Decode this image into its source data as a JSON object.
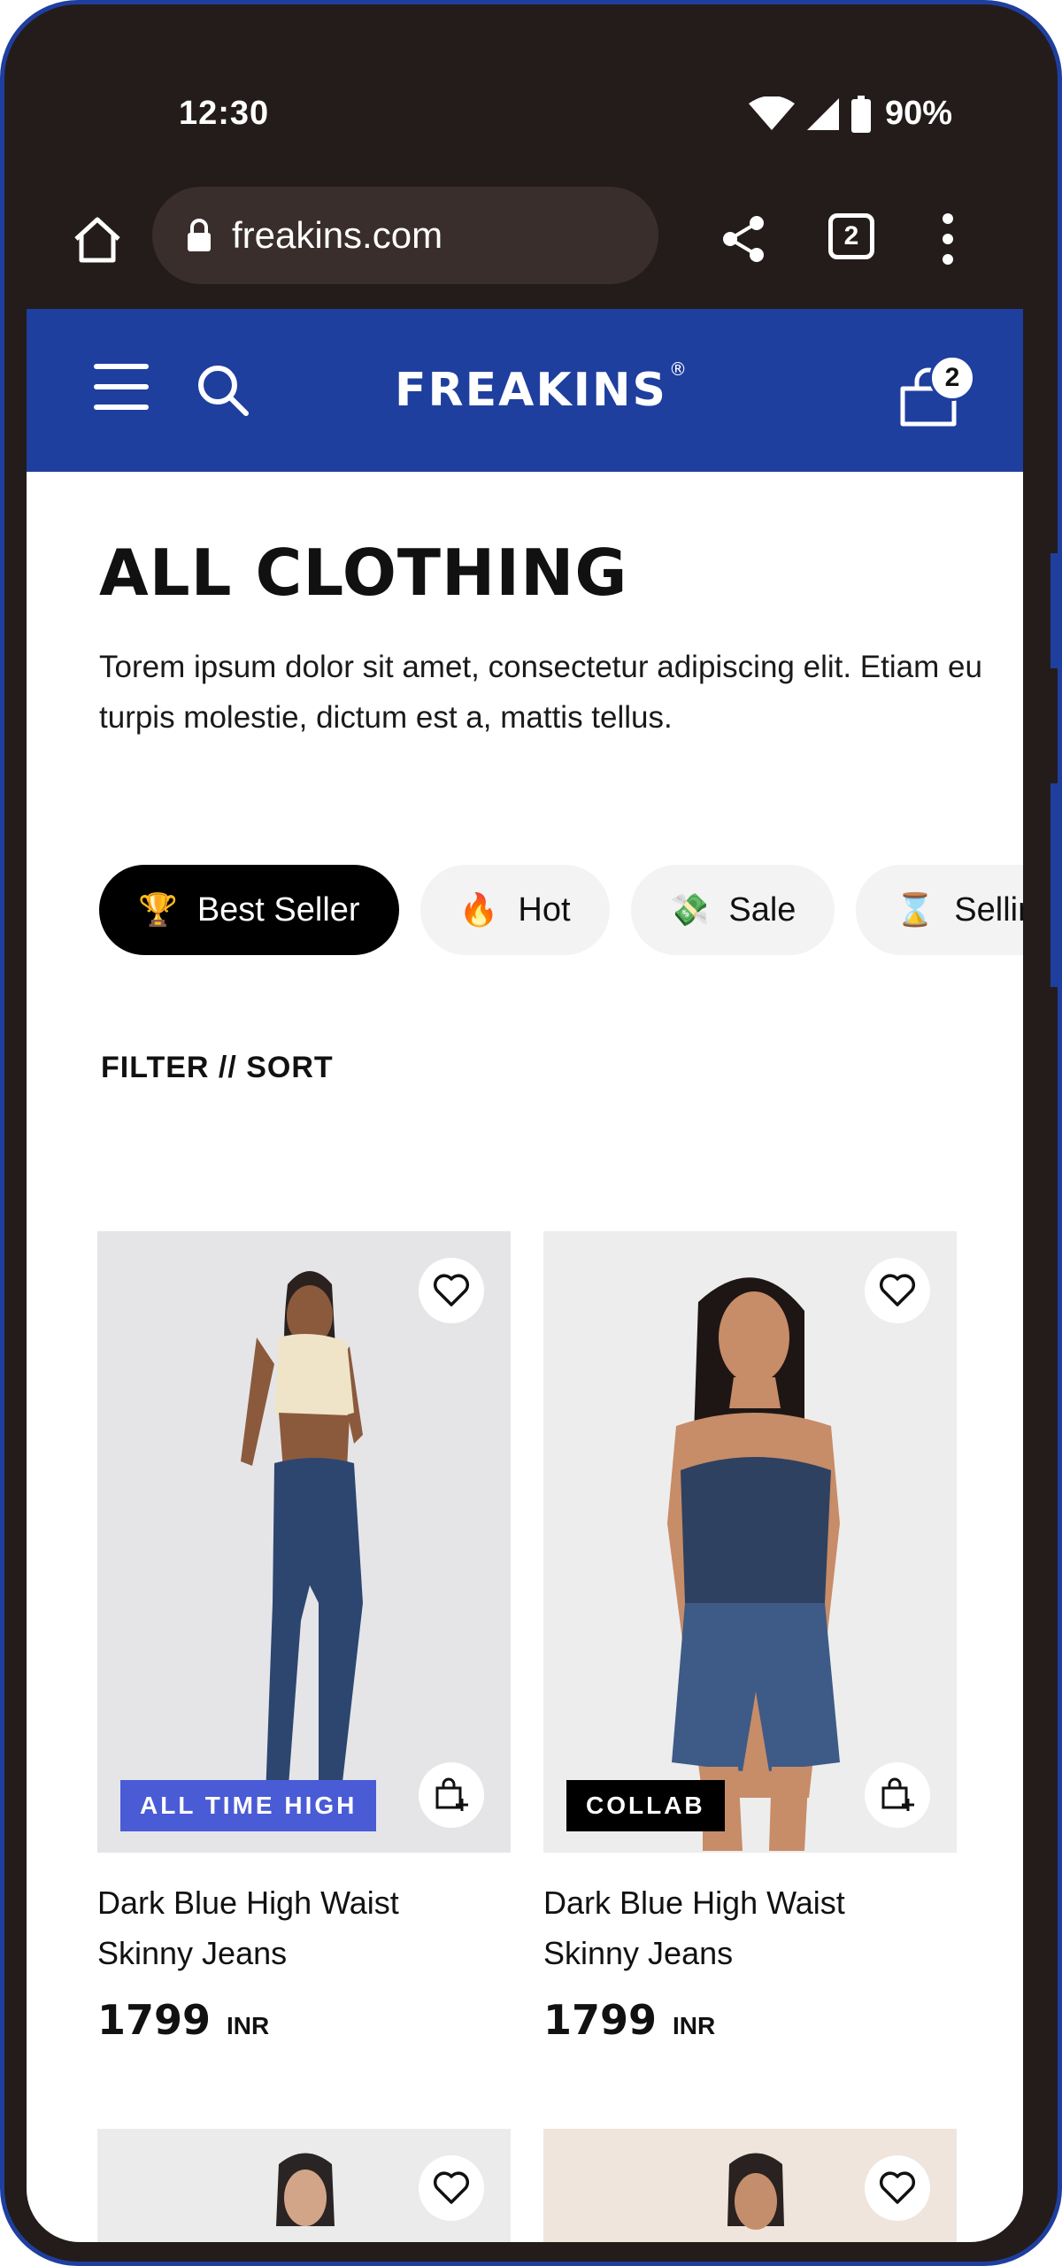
{
  "status_bar": {
    "time": "12:30",
    "battery": "90%"
  },
  "browser": {
    "url": "freakins.com",
    "tab_count": "2"
  },
  "header": {
    "logo": "FREAKINS",
    "logo_mark": "®",
    "cart_count": "2"
  },
  "page": {
    "title": "ALL CLOTHING",
    "description": "Torem ipsum dolor sit amet, consectetur adipiscing elit. Etiam eu turpis molestie, dictum est a, mattis tellus."
  },
  "chips": [
    {
      "emoji": "🏆",
      "label": "Best Seller",
      "active": true
    },
    {
      "emoji": "🔥",
      "label": "Hot",
      "active": false
    },
    {
      "emoji": "💸",
      "label": "Sale",
      "active": false
    },
    {
      "emoji": "⌛",
      "label": "Selling Fast",
      "active": false
    }
  ],
  "filter_sort": "FILTER // SORT",
  "products": [
    {
      "name": "Dark Blue High Waist Skinny Jeans",
      "price": "1799",
      "currency": "INR",
      "badge": "ALL TIME HIGH",
      "badge_color": "#4a5bd6"
    },
    {
      "name": "Dark Blue High Waist Skinny Jeans",
      "price": "1799",
      "currency": "INR",
      "badge": "COLLAB",
      "badge_color": "#000000"
    }
  ],
  "colors": {
    "brand": "#1f3f9f",
    "frame": "#231c1b"
  }
}
